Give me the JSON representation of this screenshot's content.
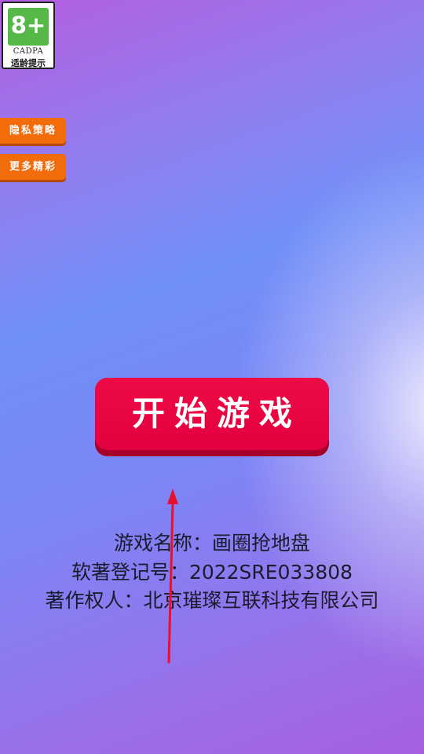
{
  "age_badge": {
    "rating": "8+",
    "org": "CADPA",
    "tip": "适龄提示"
  },
  "side_buttons": {
    "privacy_label": "隐私策略",
    "more_label": "更多精彩"
  },
  "start_button": {
    "label": "开始游戏"
  },
  "info": {
    "game_name": "游戏名称：画圈抢地盘",
    "registration": "软著登记号：2022SRE033808",
    "copyright_owner": "著作权人：北京璀璨互联科技有限公司"
  },
  "colors": {
    "side_button": "#f36c0c",
    "start_button": "#e3003e",
    "badge_green": "#56b947",
    "arrow": "#e8112d"
  }
}
